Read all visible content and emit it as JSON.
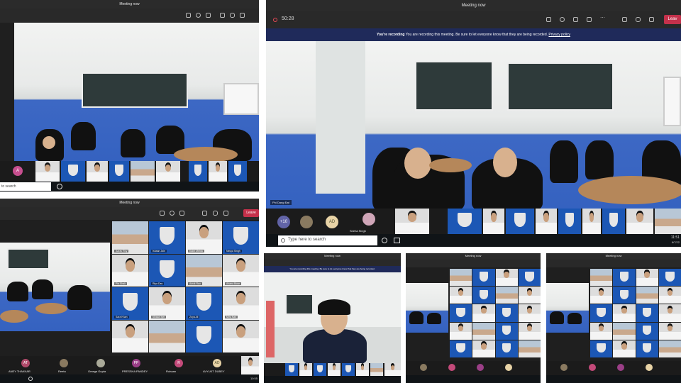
{
  "meeting_title": "Meeting now",
  "timer": "50:28",
  "leave_label": "Leave",
  "leave_short": "Leav",
  "recording": {
    "title": "You're recording",
    "message": "You are recording this meeting. Be sure to let everyone know that they are being recorded.",
    "link": "Privacy policy"
  },
  "taskbar": {
    "search_placeholder": "Type here to search",
    "search_short": "to search",
    "time": "11:51",
    "date": "6/7/22",
    "time_small": "10:55"
  },
  "main_participants": {
    "overflow": "+10",
    "initials": "AD",
    "name_sneha": "Sneha Singh",
    "name_pressha": "PRESSHA PANDEY",
    "speaker_label": "Phi Dang Đạt"
  },
  "lower_left_participants": [
    {
      "initials": "AT",
      "name": "ANEY THAKKAR"
    },
    {
      "initials": "",
      "name": "Reeta"
    },
    {
      "initials": "",
      "name": "Omega Gupta"
    },
    {
      "initials": "PP",
      "name": "PRESSHA PANDEY"
    },
    {
      "initials": "R",
      "name": "Ruhaan"
    },
    {
      "initials": "AD",
      "name": "AVYUKT DUBEY"
    }
  ],
  "gallery_names": [
    "Aarav Roy",
    "Ishaan Jain",
    "Kabir Mehta",
    "Navya Singh",
    "Pia Shah",
    "Riya Das",
    "Advik Rao",
    "Ahana Bose",
    "Sara Khan",
    "Vivaan Iyer",
    "Zoya Ali",
    "Mira Nair"
  ],
  "left_top_initials": "A",
  "theme": {
    "accent": "#6264a7",
    "leave": "#c4314b",
    "floor": "#3a6ad0",
    "recording_banner": "#1f2a5a"
  }
}
